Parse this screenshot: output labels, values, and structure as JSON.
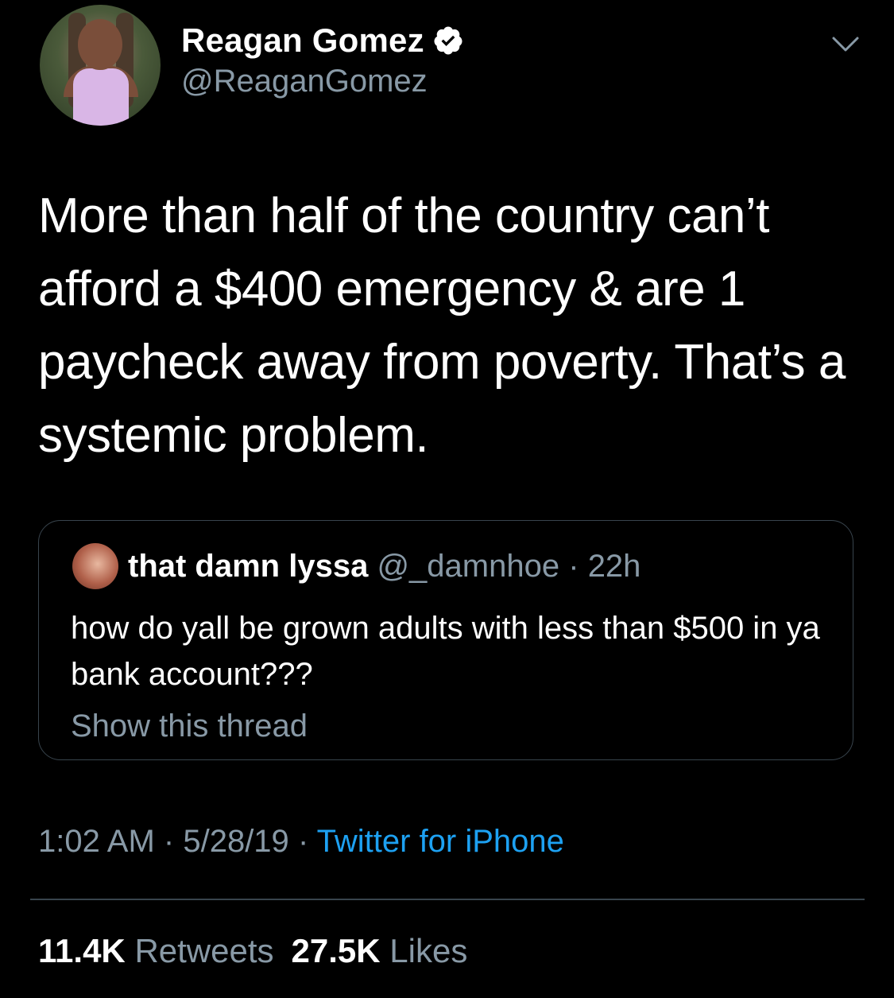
{
  "author": {
    "display_name": "Reagan Gomez",
    "handle": "@ReaganGomez",
    "verified": true,
    "avatar_icon": "profile-photo"
  },
  "tweet": {
    "text": "More than half of the country can’t afford a $400 emergency & are 1 paycheck away from poverty. That’s a systemic problem."
  },
  "quoted_tweet": {
    "display_name": "that damn lyssa",
    "handle": "@_damnhoe",
    "separator": "·",
    "time": "22h",
    "text": "how do yall be grown adults with less than $500 in ya bank account???",
    "show_thread": "Show this thread"
  },
  "meta": {
    "time": "1:02 AM",
    "separator": "·",
    "date": "5/28/19",
    "source": "Twitter for iPhone"
  },
  "stats": {
    "retweets_count": "11.4K",
    "retweets_label": "Retweets",
    "likes_count": "27.5K",
    "likes_label": "Likes"
  },
  "colors": {
    "background": "#000000",
    "text": "#ffffff",
    "secondary": "#8899a6",
    "accent": "#1da1f2",
    "border": "#38444d"
  }
}
